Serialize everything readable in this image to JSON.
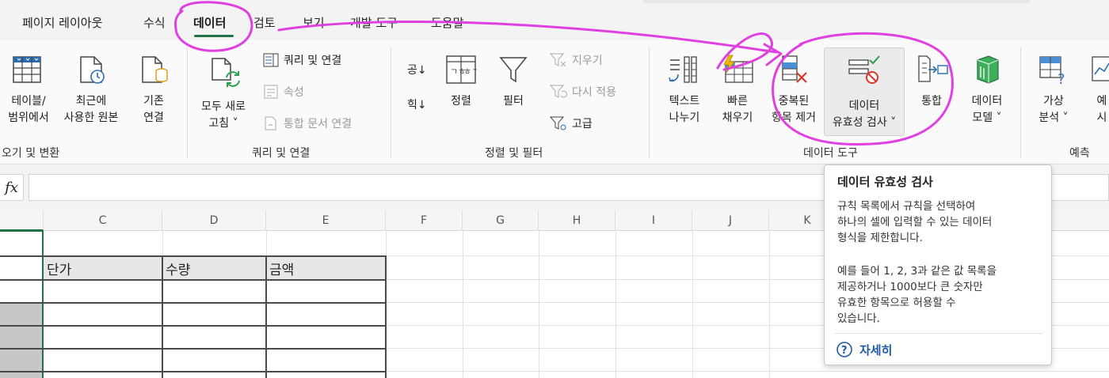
{
  "menu": {
    "items": [
      "페이지 레이아웃",
      "수식",
      "데이터",
      "검토",
      "보기",
      "개발 도구",
      "도움말"
    ],
    "active": "데이터"
  },
  "ribbon": {
    "get_transform": {
      "table_range": [
        "테이블/",
        "범위에서"
      ],
      "recent_sources": [
        "최근에",
        "사용한 원본"
      ],
      "existing_conn": [
        "기존",
        "연결"
      ],
      "group_label": "오기 및 변환"
    },
    "queries": {
      "refresh_all": [
        "모두 새로",
        "고침 ˅"
      ],
      "queries_conn": "쿼리 및 연결",
      "properties": "속성",
      "edit_links": "통합 문서 연결",
      "group_label": "쿼리 및 연결"
    },
    "sort_filter": {
      "sort_az": "공↓",
      "sort_za": "힉↓",
      "sort": "정렬",
      "filter": "필터",
      "clear": "지우기",
      "reapply": "다시 적용",
      "advanced": "고급",
      "group_label": "정렬 및 필터"
    },
    "data_tools": {
      "text_to_columns": [
        "텍스트",
        "나누기"
      ],
      "flash_fill": [
        "빠른",
        "채우기"
      ],
      "remove_duplicates": [
        "중복된",
        "항목 제거"
      ],
      "data_validation": [
        "데이터",
        "유효성 검사 ˅"
      ],
      "consolidate": "통합",
      "data_model": [
        "데이터",
        "모델 ˅"
      ],
      "group_label": "데이터 도구"
    },
    "forecast": {
      "what_if": [
        "가상",
        "분석 ˅"
      ],
      "forecast_sheet": [
        "예",
        "시"
      ],
      "group_label": "예측"
    }
  },
  "formula_bar": {
    "fx": "fx",
    "value": ""
  },
  "grid": {
    "columns": [
      "C",
      "D",
      "E",
      "F",
      "G",
      "H",
      "I",
      "J",
      "K"
    ],
    "table_headers": [
      "단가",
      "수량",
      "금액"
    ]
  },
  "tooltip": {
    "title": "데이터 유효성 검사",
    "para1": [
      "규칙 목록에서 규칙을 선택하여",
      "하나의 셀에 입력할 수 있는 데이터",
      "형식을 제한합니다."
    ],
    "para2": [
      "예를 들어 1, 2, 3과 같은 값 목록을",
      "제공하거나 1000보다 큰 숫자만",
      "유효한 항목으로 허용할 수",
      "있습니다."
    ],
    "help": "자세히"
  },
  "colors": {
    "accent_green": "#217346",
    "annotation_magenta": "#e040e0",
    "help_blue": "#1f5aa6"
  }
}
